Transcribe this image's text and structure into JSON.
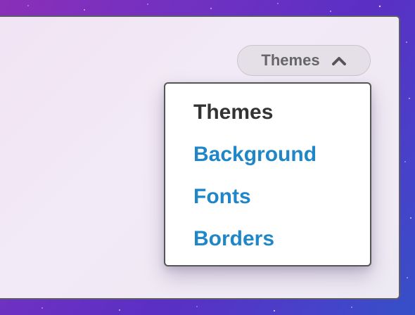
{
  "themes_button": {
    "label": "Themes",
    "icon": "chevron-up-icon"
  },
  "menu": {
    "header": "Themes",
    "items": [
      {
        "label": "Background"
      },
      {
        "label": "Fonts"
      },
      {
        "label": "Borders"
      }
    ]
  },
  "colors": {
    "link": "#1f86c8",
    "header_text": "#333333",
    "button_text": "#666666",
    "button_bg": "#e5e0e8",
    "menu_bg": "#ffffff",
    "menu_border": "#555555"
  }
}
